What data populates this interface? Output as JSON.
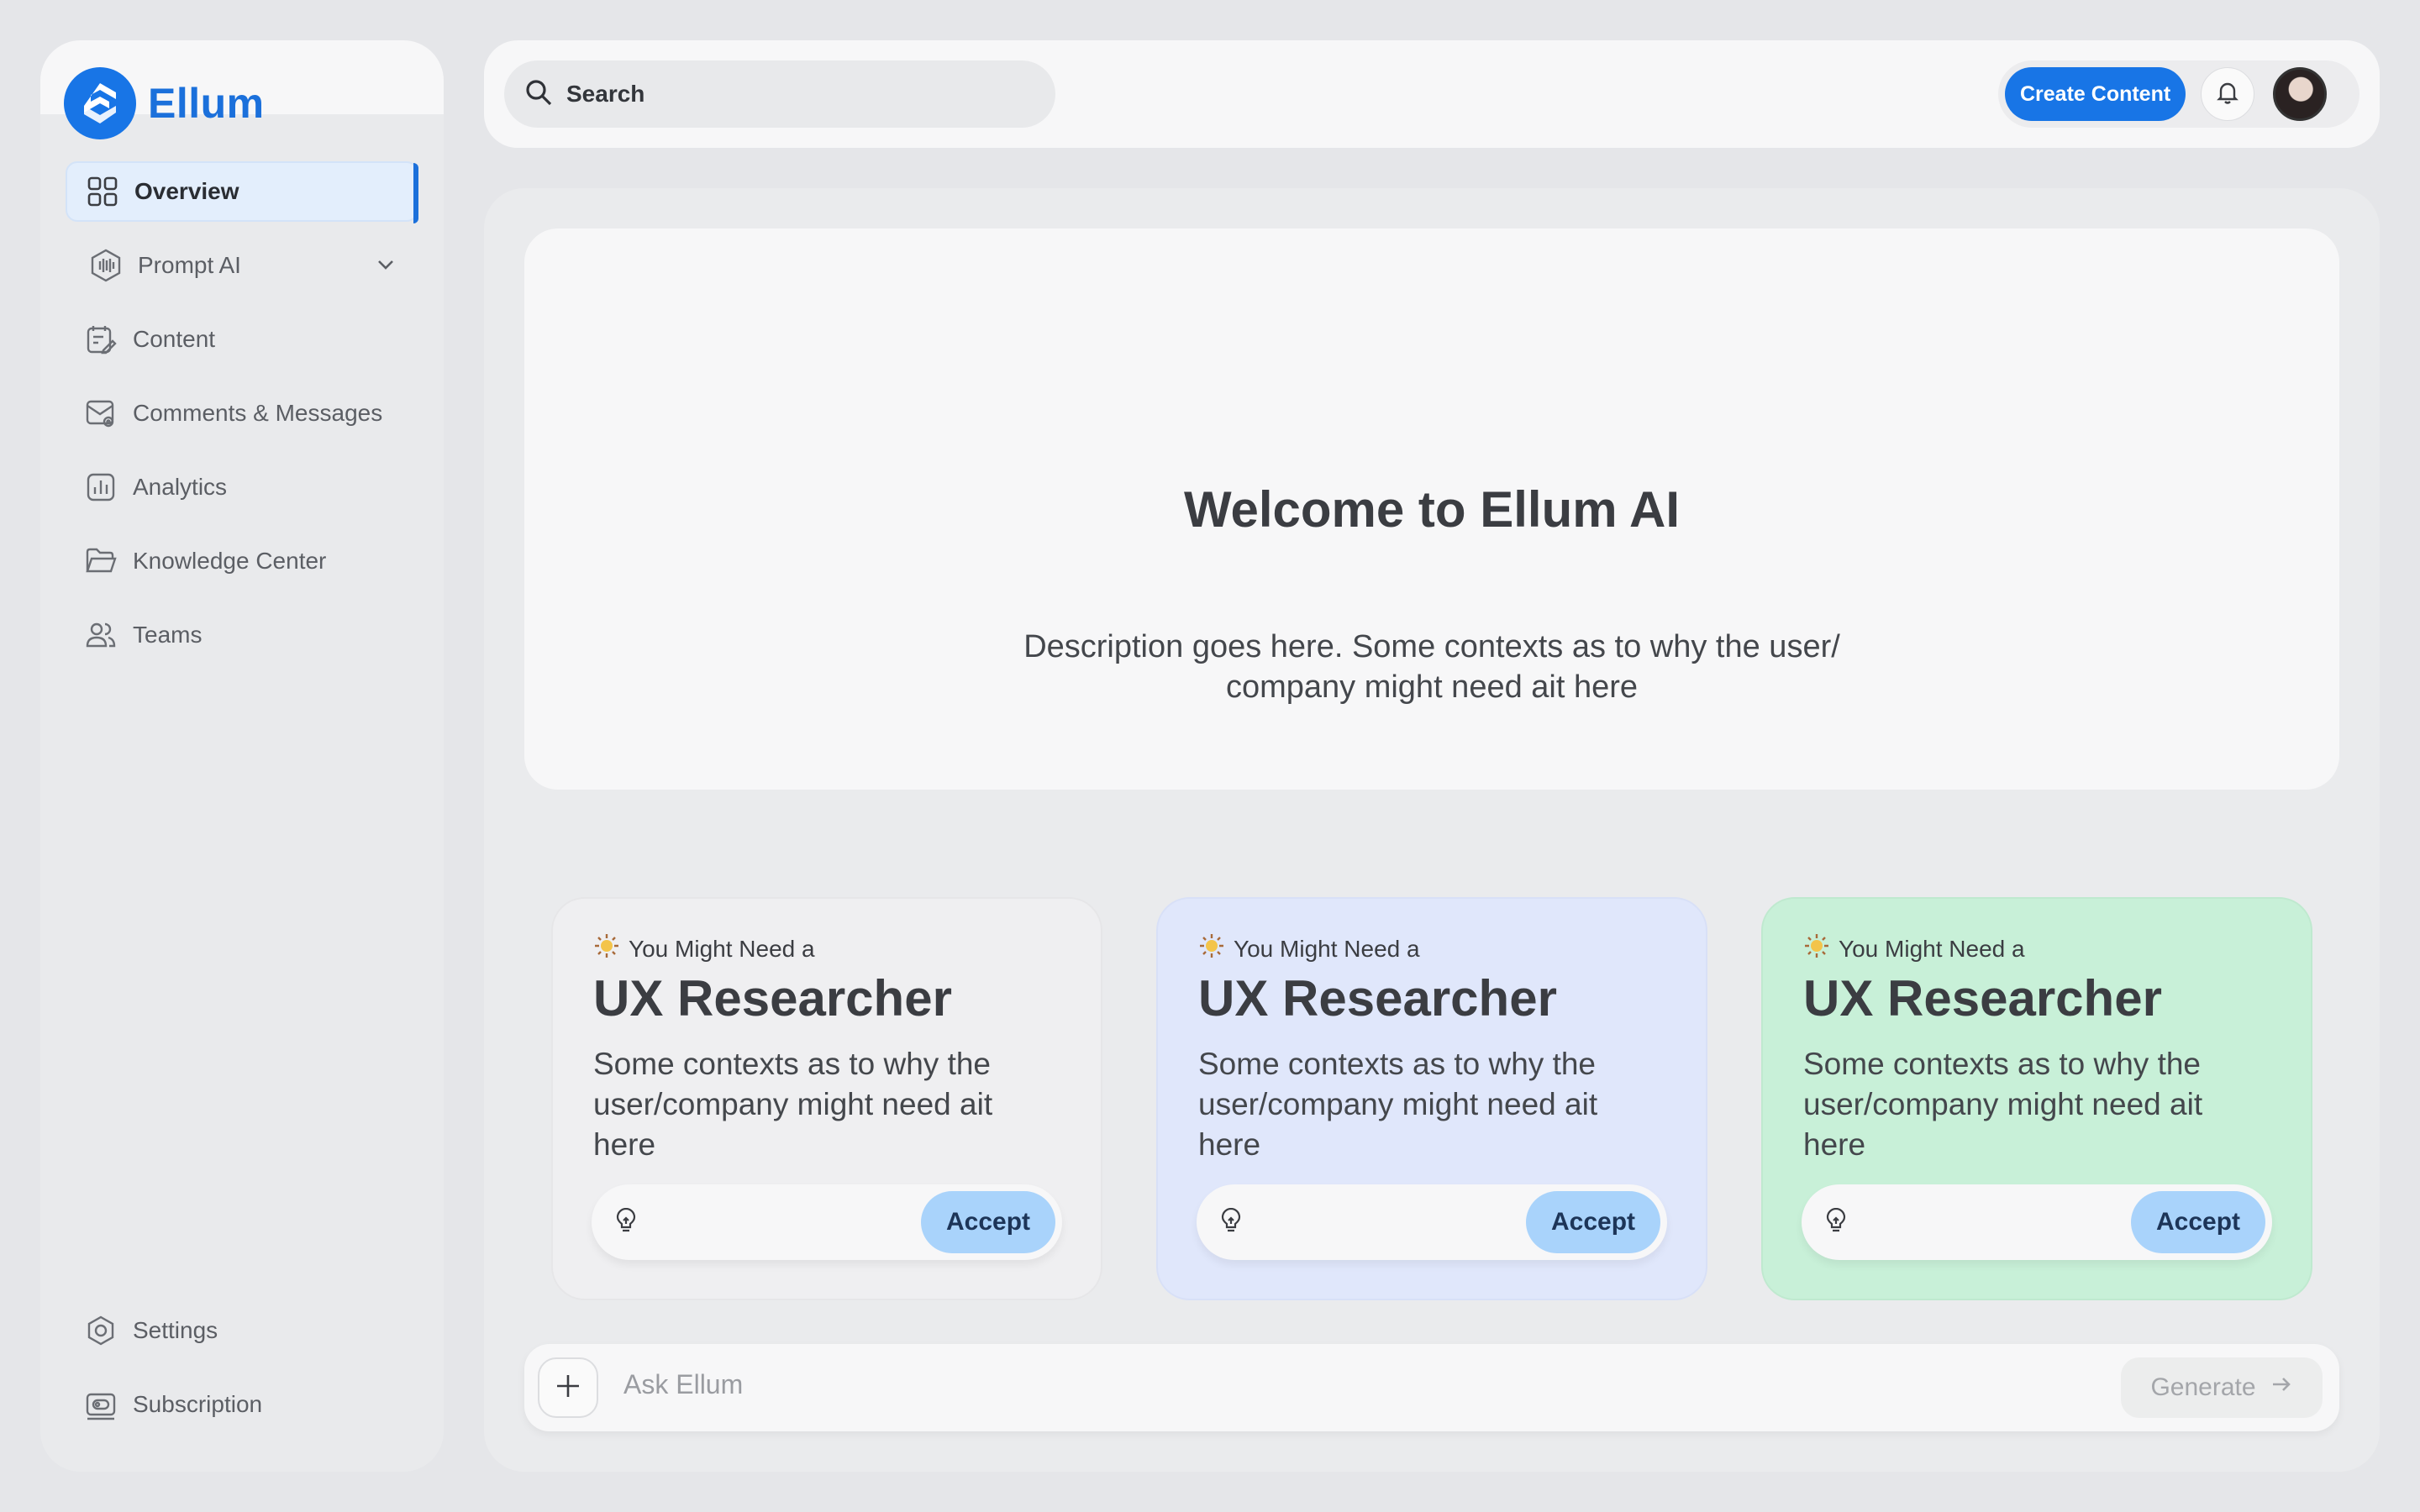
{
  "app": {
    "name": "Ellum"
  },
  "sidebar": {
    "items": [
      {
        "label": "Overview",
        "icon": "grid-icon",
        "active": true
      },
      {
        "label": "Prompt AI",
        "icon": "hexagon-wave-icon",
        "expandable": true
      },
      {
        "label": "Content",
        "icon": "content-edit-icon"
      },
      {
        "label": "Comments & Messages",
        "icon": "message-at-icon"
      },
      {
        "label": "Analytics",
        "icon": "bar-chart-icon"
      },
      {
        "label": "Knowledge Center",
        "icon": "folder-icon"
      },
      {
        "label": "Teams",
        "icon": "users-icon"
      }
    ],
    "bottom_items": [
      {
        "label": "Settings",
        "icon": "settings-icon"
      },
      {
        "label": "Subscription",
        "icon": "subscription-icon"
      }
    ]
  },
  "header": {
    "search_label": "Search",
    "create_button": "Create Content"
  },
  "hero": {
    "title": "Welcome to Ellum AI",
    "description": "Description goes here. Some contexts as to why the user/ company might need ait here"
  },
  "cards": [
    {
      "eyebrow": "You Might Need a",
      "title": "UX Researcher",
      "body": "Some contexts as to why the user/company might need ait here",
      "accept": "Accept",
      "color": "#efeff1"
    },
    {
      "eyebrow": "You Might Need a",
      "title": "UX Researcher",
      "body": "Some contexts as to why the user/company might need ait here",
      "accept": "Accept",
      "color": "#e0e7fb"
    },
    {
      "eyebrow": "You Might Need a",
      "title": "UX Researcher",
      "body": "Some contexts as to why the user/company might need ait here",
      "accept": "Accept",
      "color": "#c8f0d8"
    }
  ],
  "ask": {
    "placeholder": "Ask Ellum",
    "generate_label": "Generate"
  },
  "colors": {
    "accent": "#1875e6",
    "accept_button": "#a9d3fb"
  }
}
